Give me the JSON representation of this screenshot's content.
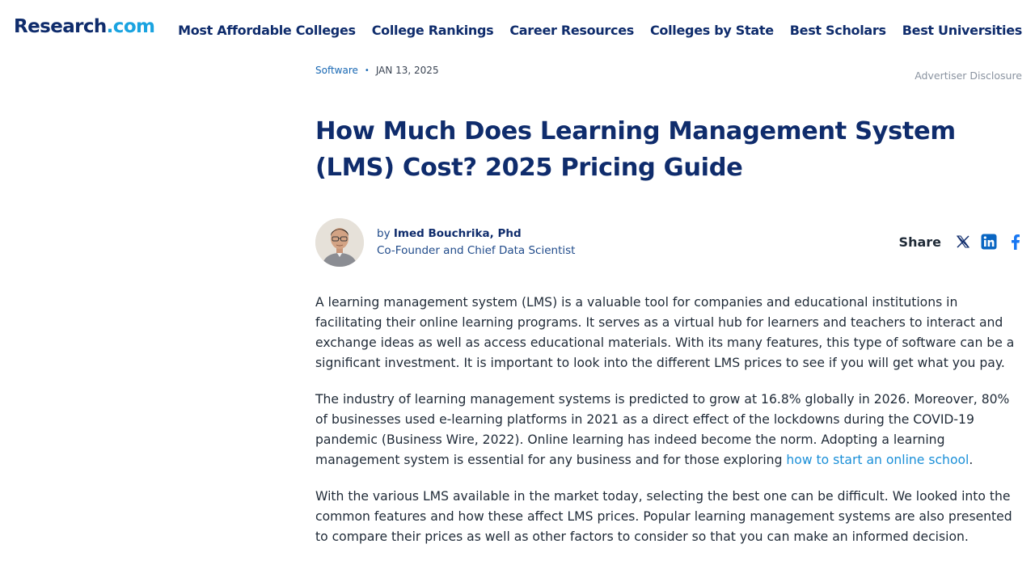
{
  "header": {
    "logo_main": "Research",
    "logo_tld": ".com",
    "nav": [
      "Most Affordable Colleges",
      "College Rankings",
      "Career Resources",
      "Colleges by State",
      "Best Scholars",
      "Best Universities"
    ]
  },
  "article": {
    "category": "Software",
    "date": "JAN 13, 2025",
    "disclosure": "Advertiser Disclosure",
    "title": "How Much Does Learning Management System (LMS) Cost? 2025 Pricing Guide",
    "author": {
      "by": "by",
      "name": "Imed Bouchrika, Phd",
      "role": "Co-Founder and Chief Data Scientist"
    },
    "share": {
      "label": "Share",
      "icons": [
        "x-twitter-icon",
        "linkedin-icon",
        "facebook-icon"
      ]
    },
    "paragraphs": [
      "A learning management system (LMS) is a valuable tool for companies and educational institutions in facilitating their online learning programs. It serves as a virtual hub for learners and teachers to interact and exchange ideas as well as access educational materials. With its many features, this type of software can be a significant investment. It is important to look into the different LMS prices to see if you will get what you pay.",
      "The industry of learning management systems is predicted to grow at 16.8% globally in 2026. Moreover, 80% of businesses used e-learning platforms in 2021 as a direct effect of the lockdowns during the COVID-19 pandemic (Business Wire, 2022). Online learning has indeed become the norm. Adopting a learning management system is essential for any business and for those exploring ",
      "With the various LMS available in the market today, selecting the best one can be difficult. We looked into the common features and how these affect LMS prices. Popular learning management systems are also presented to compare their prices as well as other factors to consider so that you can make an informed decision."
    ],
    "p2_link": "how to start an online school",
    "p2_end": "."
  },
  "colors": {
    "brand_navy": "#0f2c6c",
    "brand_cyan": "#1aa3e0",
    "link_blue": "#1a8fd8",
    "linkedin": "#0a66c2",
    "facebook": "#1877f2"
  }
}
